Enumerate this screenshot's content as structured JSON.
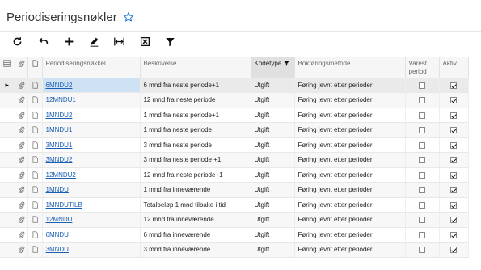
{
  "page": {
    "title": "Periodiseringsnøkler",
    "favorite_icon": "star-icon"
  },
  "toolbar": [
    {
      "name": "refresh-button",
      "icon": "refresh-icon"
    },
    {
      "name": "undo-button",
      "icon": "undo-icon"
    },
    {
      "name": "add-button",
      "icon": "plus-icon"
    },
    {
      "name": "edit-button",
      "icon": "pencil-icon"
    },
    {
      "name": "fit-columns-button",
      "icon": "column-width-icon"
    },
    {
      "name": "delete-button",
      "icon": "delete-icon"
    },
    {
      "name": "filter-button",
      "icon": "filter-icon"
    }
  ],
  "columns": {
    "key": "Periodiseringsnøkkel",
    "description": "Beskrivelse",
    "code_type": "Kodetype",
    "method": "Bokføringsmetode",
    "permanent": "Varest\nperiod",
    "active": "Aktiv"
  },
  "rows": [
    {
      "key": "6MNDU2",
      "description": "6 mnd fra neste periode+1",
      "code_type": "Utgift",
      "method": "Føring jevnt etter perioder",
      "permanent": false,
      "active": true,
      "selected": true
    },
    {
      "key": "12MNDU1",
      "description": "12 mnd fra neste periode",
      "code_type": "Utgift",
      "method": "Føring jevnt etter perioder",
      "permanent": false,
      "active": true
    },
    {
      "key": "1MNDU2",
      "description": "1 mnd fra neste periode+1",
      "code_type": "Utgift",
      "method": "Føring jevnt etter perioder",
      "permanent": false,
      "active": true
    },
    {
      "key": "1MNDU1",
      "description": "1 mnd fra neste periode",
      "code_type": "Utgift",
      "method": "Føring jevnt etter perioder",
      "permanent": false,
      "active": true
    },
    {
      "key": "3MNDU1",
      "description": "3 mnd fra neste periode",
      "code_type": "Utgift",
      "method": "Føring jevnt etter perioder",
      "permanent": false,
      "active": true
    },
    {
      "key": "3MNDU2",
      "description": "3 mnd fra neste periode +1",
      "code_type": "Utgift",
      "method": "Føring jevnt etter perioder",
      "permanent": false,
      "active": true
    },
    {
      "key": "12MNDU2",
      "description": "12 mnd fra neste periode+1",
      "code_type": "Utgift",
      "method": "Føring jevnt etter perioder",
      "permanent": false,
      "active": true
    },
    {
      "key": "1MNDU",
      "description": "1 mnd fra inneværende",
      "code_type": "Utgift",
      "method": "Føring jevnt etter perioder",
      "permanent": false,
      "active": true
    },
    {
      "key": "1MNDUTILB",
      "description": "Totalbeløp 1 mnd tilbake i tid",
      "code_type": "Utgift",
      "method": "Føring jevnt etter perioder",
      "permanent": false,
      "active": true
    },
    {
      "key": "12MNDU",
      "description": "12 mnd fra inneværende",
      "code_type": "Utgift",
      "method": "Føring jevnt etter perioder",
      "permanent": false,
      "active": true
    },
    {
      "key": "6MNDU",
      "description": "6 mnd fra inneværende",
      "code_type": "Utgift",
      "method": "Føring jevnt etter perioder",
      "permanent": false,
      "active": true
    },
    {
      "key": "3MNDU",
      "description": "3 mnd fra inneværende",
      "code_type": "Utgift",
      "method": "Føring jevnt etter perioder",
      "permanent": false,
      "active": true
    }
  ],
  "colors": {
    "link": "#1a5fb4",
    "star": "#2a7bd3",
    "selected_cell": "#cfe2f3",
    "sorted_header": "#e0e0e0"
  }
}
